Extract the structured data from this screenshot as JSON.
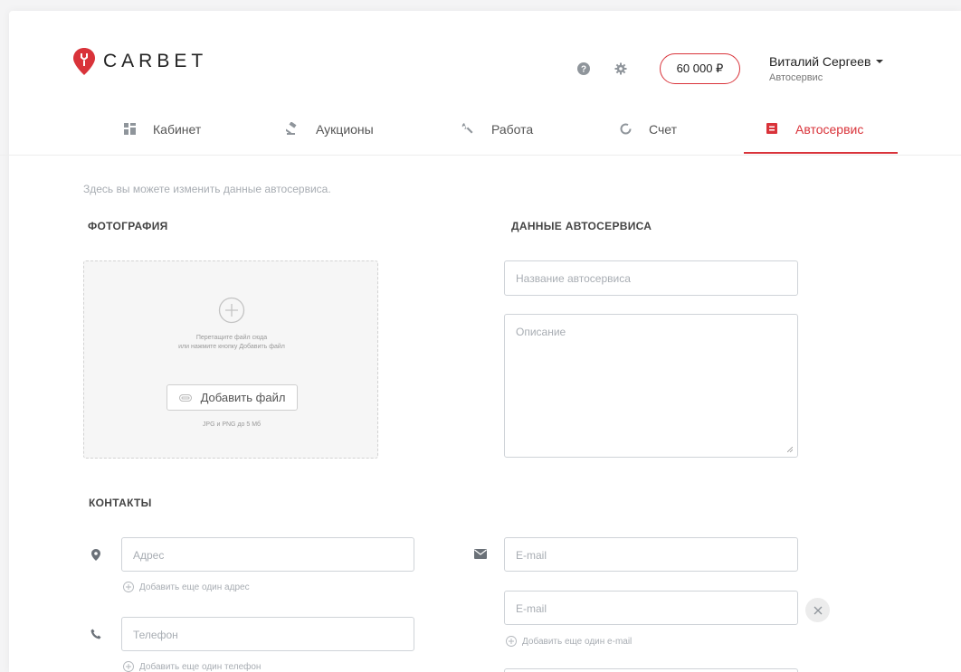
{
  "header": {
    "logo_text": "CARBET",
    "balance": "60 000 ₽",
    "user_name": "Виталий Сергеев",
    "user_role": "Автосервис"
  },
  "nav": {
    "items": [
      {
        "label": "Кабинет",
        "icon": "dashboard-icon"
      },
      {
        "label": "Аукционы",
        "icon": "gavel-icon"
      },
      {
        "label": "Работа",
        "icon": "wrench-icon"
      },
      {
        "label": "Счет",
        "icon": "circle-chart-icon"
      },
      {
        "label": "Автосервис",
        "icon": "document-icon",
        "active": true
      }
    ]
  },
  "main": {
    "intro": "Здесь вы можете изменить данные автосервиса.",
    "photo_title": "ФОТОГРАФИЯ",
    "data_title": "ДАННЫЕ АВТОСЕРВИСА",
    "contacts_title": "КОНТАКТЫ",
    "dropzone": {
      "hint_line1": "Перетащите файл сюда",
      "hint_line2": "или нажмите кнопку Добавить файл",
      "button_label": "Добавить файл",
      "formats": "JPG и PNG до 5 Мб"
    },
    "name_placeholder": "Название автосервиса",
    "description_placeholder": "Описание",
    "address_placeholder": "Адрес",
    "add_address": "Добавить еще один адрес",
    "phone_placeholder": "Телефон",
    "add_phone": "Добавить еще один телефон",
    "email_placeholder_1": "E-mail",
    "email_placeholder_2": "E-mail",
    "add_email": "Добавить еще один e-mail"
  },
  "colors": {
    "accent": "#d9333a",
    "text": "#222222",
    "muted": "#a8adb3"
  }
}
